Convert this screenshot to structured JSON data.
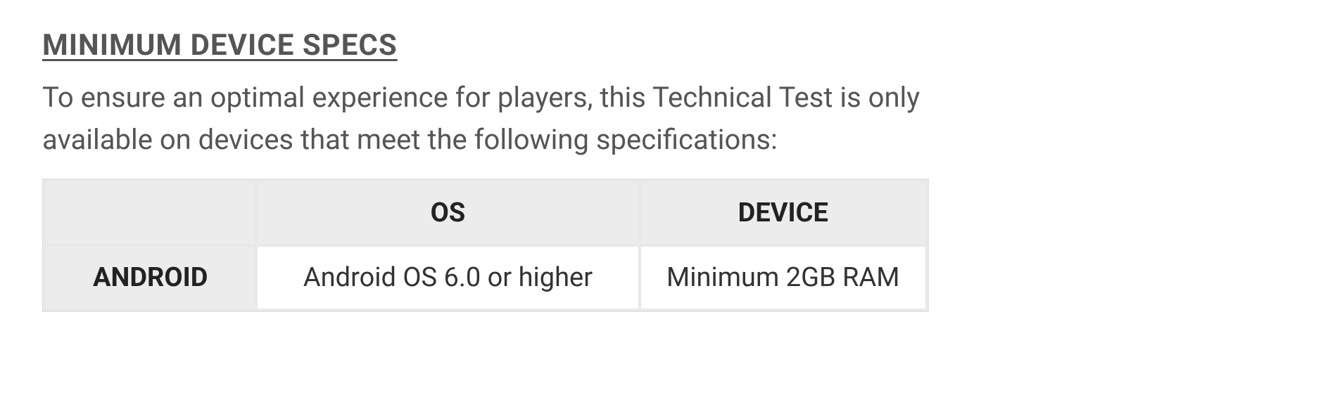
{
  "section": {
    "title": "MINIMUM DEVICE SPECS",
    "description": "To ensure an optimal experience for players, this Technical Test is only available on devices that meet the following specifications:"
  },
  "table": {
    "headers": {
      "empty": "",
      "os": "OS",
      "device": "DEVICE"
    },
    "rows": [
      {
        "platform": "ANDROID",
        "os": "Android OS 6.0 or higher",
        "device": "Minimum 2GB RAM"
      }
    ]
  }
}
